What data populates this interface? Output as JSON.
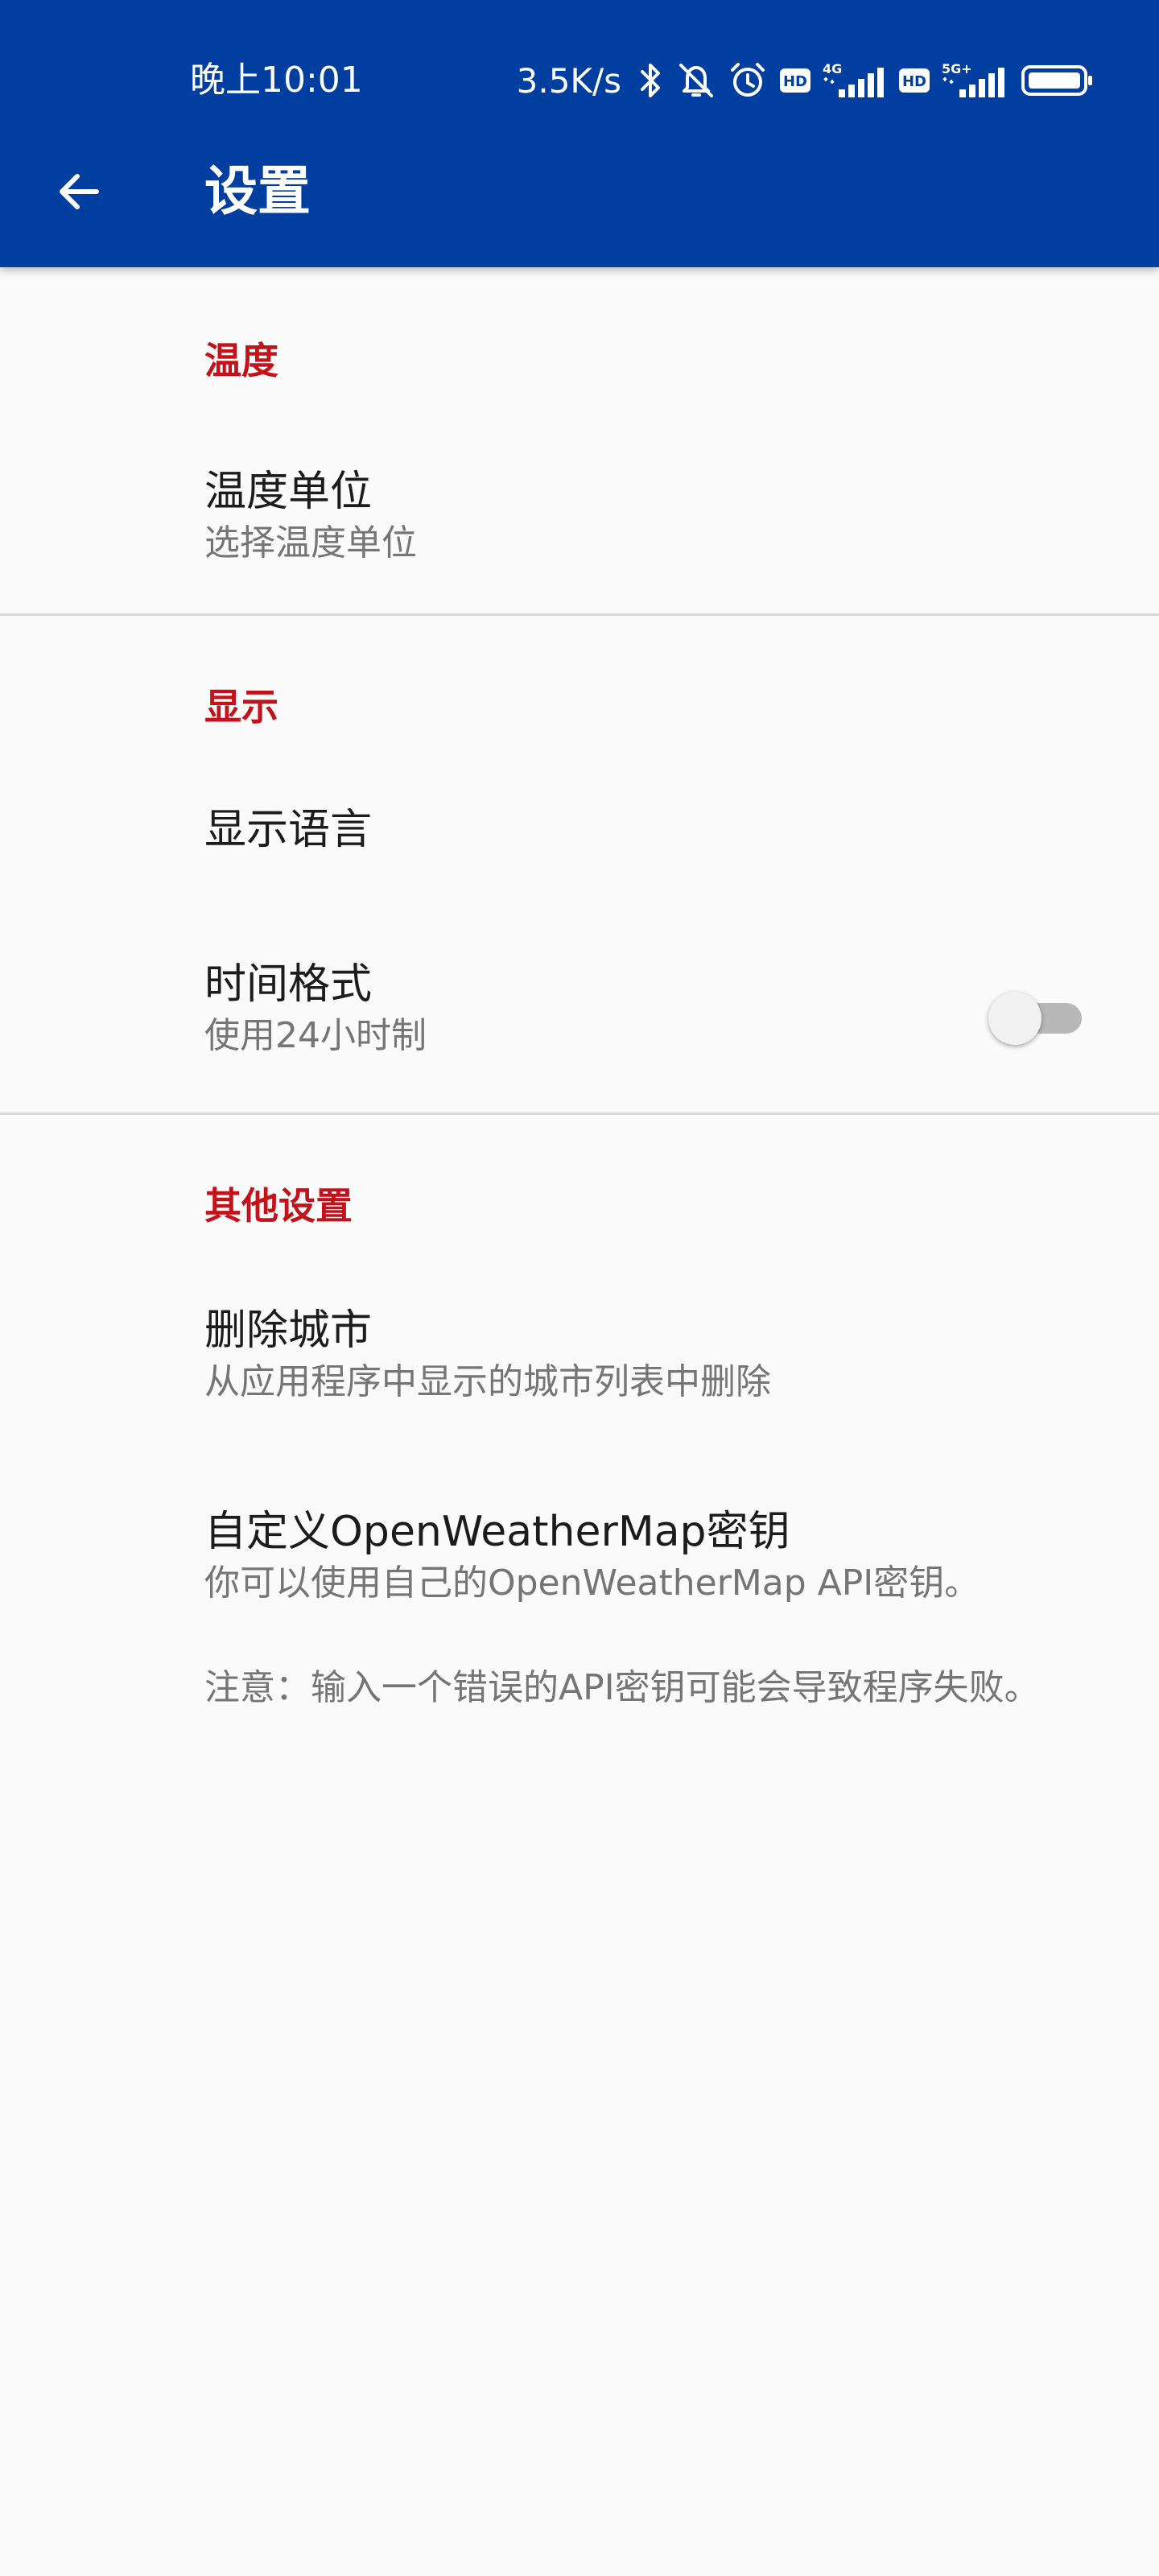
{
  "status_bar": {
    "time": "晚上10:01",
    "net_speed": "3.5K/s",
    "signal1_label": "4G",
    "signal2_label": "5G+",
    "hd_label": "HD"
  },
  "toolbar": {
    "title": "设置"
  },
  "sections": {
    "temperature": {
      "header": "温度",
      "unit_title": "温度单位",
      "unit_summary": "选择温度单位"
    },
    "display": {
      "header": "显示",
      "language_title": "显示语言",
      "time_format_title": "时间格式",
      "time_format_summary": "使用24小时制",
      "time_format_enabled": false
    },
    "other": {
      "header": "其他设置",
      "delete_city_title": "删除城市",
      "delete_city_summary": "从应用程序中显示的城市列表中删除",
      "api_key_title": "自定义OpenWeatherMap密钥",
      "api_key_summary_line1": "你可以使用自己的OpenWeatherMap API密钥。",
      "api_key_summary_line2": "注意：输入一个错误的API密钥可能会导致程序失败。"
    }
  },
  "colors": {
    "appbar": "#003f9f",
    "section_header": "#c4121b",
    "background": "#fafafa"
  }
}
